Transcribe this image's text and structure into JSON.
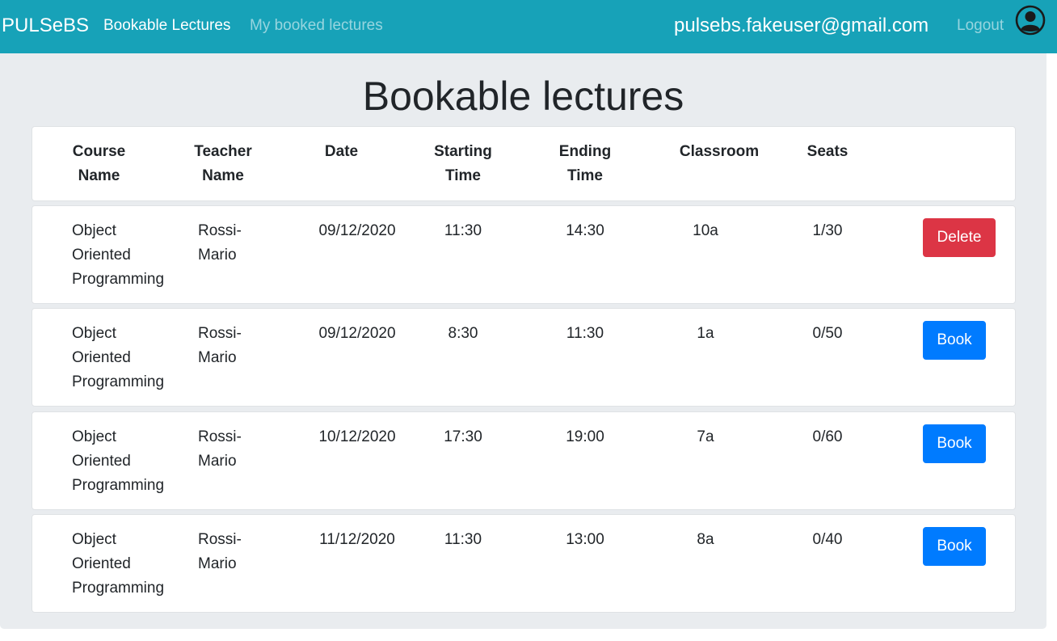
{
  "navbar": {
    "brand": "PULSeBS",
    "links": [
      {
        "label": "Bookable Lectures",
        "active": true
      },
      {
        "label": "My booked lectures",
        "active": false
      }
    ],
    "user_email": "pulsebs.fakeuser@gmail.com",
    "logout_label": "Logout",
    "avatar_icon": "user-circle-icon"
  },
  "page": {
    "title": "Bookable lectures"
  },
  "table": {
    "headers": {
      "course_line1": "Course",
      "course_line2": "Name",
      "teacher_line1": "Teacher",
      "teacher_line2": "Name",
      "date": "Date",
      "start_line1": "Starting",
      "start_line2": "Time",
      "end_line1": "Ending",
      "end_line2": "Time",
      "classroom": "Classroom",
      "seats": "Seats"
    },
    "rows": [
      {
        "course_l1": "Object",
        "course_l2": "Oriented",
        "course_l3": "Programming",
        "teacher_l1": "Rossi-",
        "teacher_l2": "Mario",
        "date": "09/12/2020",
        "start": "11:30",
        "end": "14:30",
        "classroom": "10a",
        "seats": "1/30",
        "action": "Delete"
      },
      {
        "course_l1": "Object",
        "course_l2": "Oriented",
        "course_l3": "Programming",
        "teacher_l1": "Rossi-",
        "teacher_l2": "Mario",
        "date": "09/12/2020",
        "start": "8:30",
        "end": "11:30",
        "classroom": "1a",
        "seats": "0/50",
        "action": "Book"
      },
      {
        "course_l1": "Object",
        "course_l2": "Oriented",
        "course_l3": "Programming",
        "teacher_l1": "Rossi-",
        "teacher_l2": "Mario",
        "date": "10/12/2020",
        "start": "17:30",
        "end": "19:00",
        "classroom": "7a",
        "seats": "0/60",
        "action": "Book"
      },
      {
        "course_l1": "Object",
        "course_l2": "Oriented",
        "course_l3": "Programming",
        "teacher_l1": "Rossi-",
        "teacher_l2": "Mario",
        "date": "11/12/2020",
        "start": "11:30",
        "end": "13:00",
        "classroom": "8a",
        "seats": "0/40",
        "action": "Book"
      }
    ]
  },
  "colors": {
    "navbar": "#17a2b8",
    "delete": "#dc3545",
    "book": "#007bff",
    "background": "#e9ecef"
  }
}
